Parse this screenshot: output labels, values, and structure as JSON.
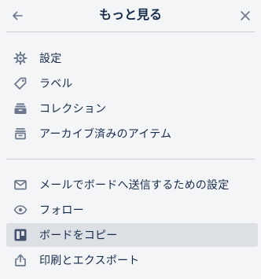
{
  "header": {
    "title": "もっと見る"
  },
  "group1": [
    {
      "label": "設定",
      "icon": "gear-icon"
    },
    {
      "label": "ラベル",
      "icon": "tag-icon"
    },
    {
      "label": "コレクション",
      "icon": "collection-icon"
    },
    {
      "label": "アーカイブ済みのアイテム",
      "icon": "archive-icon"
    }
  ],
  "group2": [
    {
      "label": "メールでボードへ送信するための設定",
      "icon": "email-icon"
    },
    {
      "label": "フォロー",
      "icon": "eye-icon"
    },
    {
      "label": "ボードをコピー",
      "icon": "board-copy-icon",
      "active": true
    },
    {
      "label": "印刷とエクスポート",
      "icon": "share-icon"
    }
  ],
  "colors": {
    "background": "#f4f5f7",
    "active_row": "#dcdfe4",
    "icon": "#6b778c",
    "text": "#172b4d"
  }
}
